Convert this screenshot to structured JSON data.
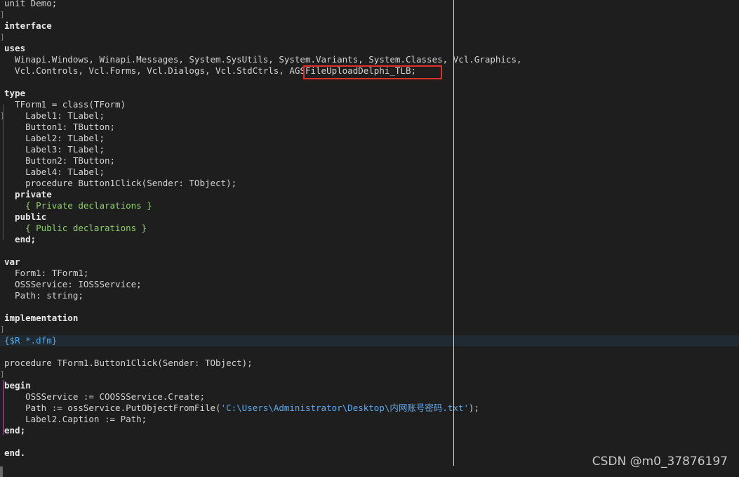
{
  "code": {
    "l01": "unit Demo;",
    "l02": "interface",
    "l03": "uses",
    "l04": "  Winapi.Windows, Winapi.Messages, System.SysUtils, System.Variants, System.Classes, Vcl.Graphics,",
    "l05a": "  Vcl.Controls, Vcl.Forms, Vcl.Dialogs, Vcl.StdCtrls, ",
    "l05b": "AGSFileUploadDelphi_TLB;",
    "l06": "type",
    "l07": "  TForm1 = class(TForm)",
    "l08": "    Label1: TLabel;",
    "l09": "    Button1: TButton;",
    "l10": "    Label2: TLabel;",
    "l11": "    Label3: TLabel;",
    "l12": "    Button2: TButton;",
    "l13": "    Label4: TLabel;",
    "l14": "    procedure Button1Click(Sender: TObject);",
    "l15": "  private",
    "l16": "    { Private declarations }",
    "l17": "  public",
    "l18": "    { Public declarations }",
    "l19": "  end;",
    "l20": "var",
    "l21": "  Form1: TForm1;",
    "l22": "  OSSService: IOSSService;",
    "l23": "  Path: string;",
    "l24": "implementation",
    "l25": "{$R *.dfm}",
    "l26": "procedure TForm1.Button1Click(Sender: TObject);",
    "l27": "begin",
    "l28": "    OSSService := COOSSService.Create;",
    "l29a": "    Path := ossService.PutObjectFromFile(",
    "l29b": "'C:\\Users\\Administrator\\Desktop\\内网账号密码.txt'",
    "l29c": ");",
    "l30": "    Label2.Caption := Path;",
    "l31": "end;",
    "l32": "end."
  },
  "watermark": "CSDN @m0_37876197",
  "colors": {
    "background": "#1e1e1e",
    "highlight_box": "#e0302a",
    "comment": "#8fd06a",
    "directive": "#4ea6ea"
  }
}
